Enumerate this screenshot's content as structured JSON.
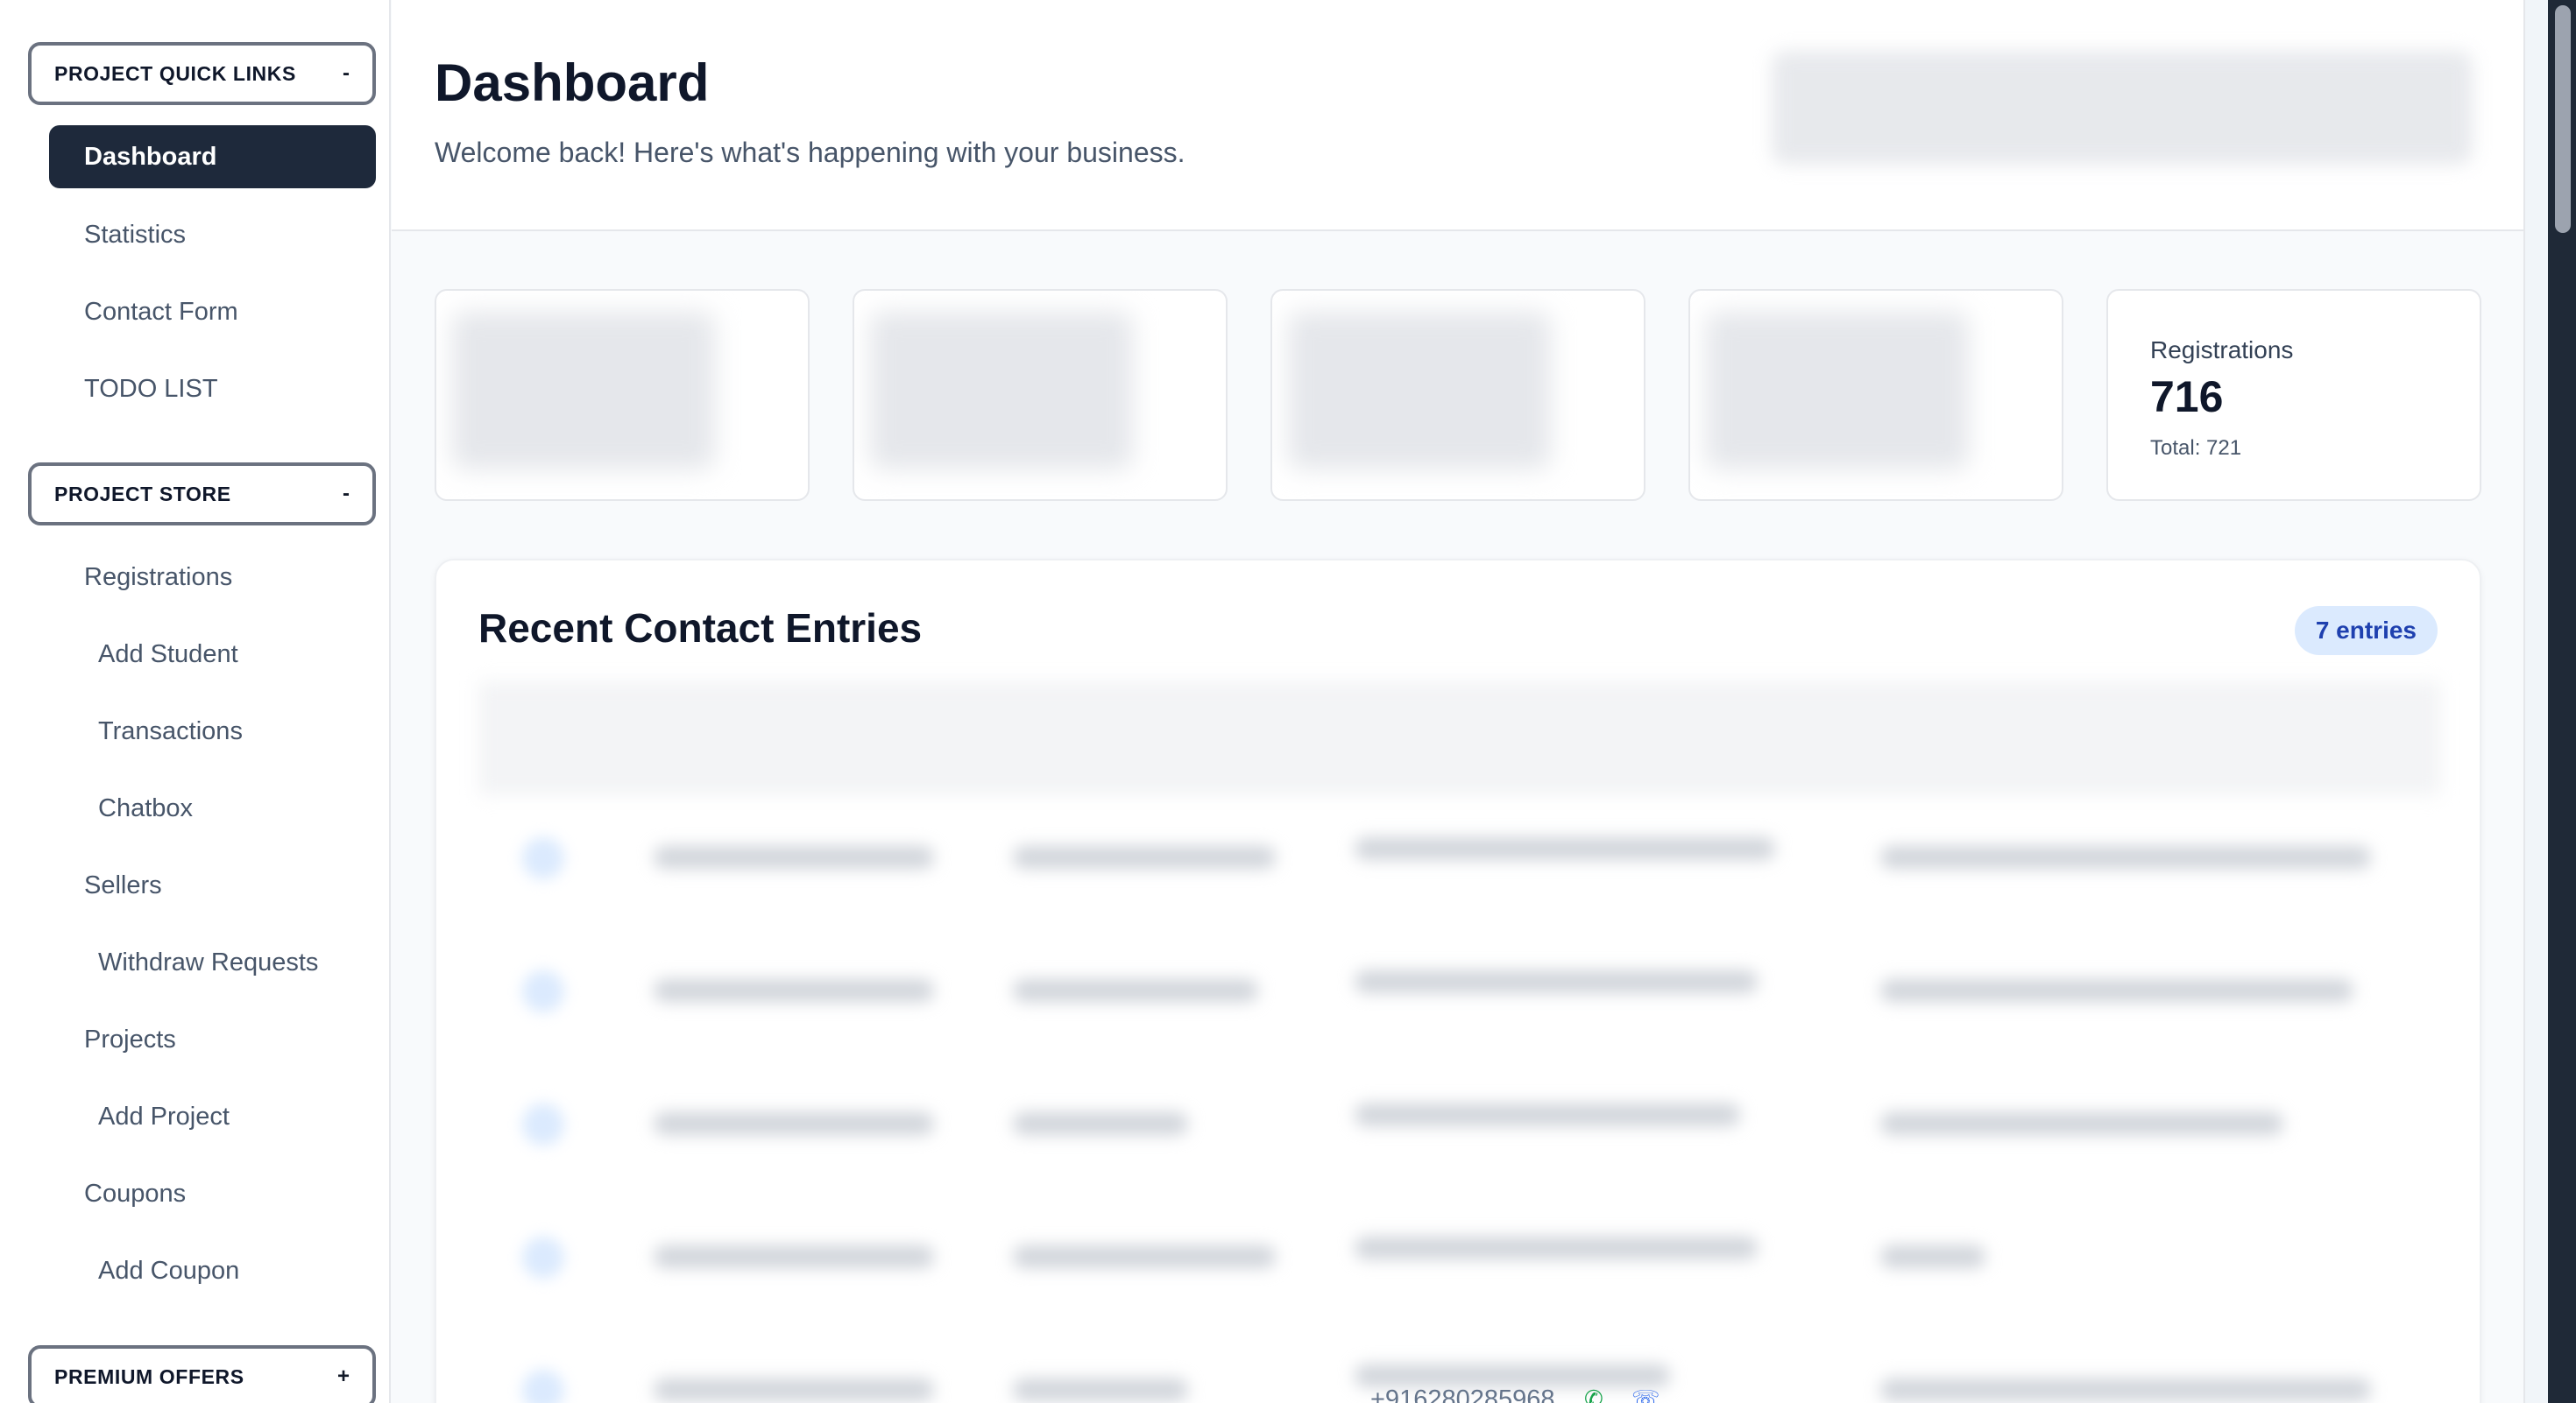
{
  "sidebar": {
    "groups": [
      {
        "label": "PROJECT QUICK LINKS",
        "toggle": "-"
      },
      {
        "label": "PROJECT STORE",
        "toggle": "-"
      },
      {
        "label": "PREMIUM OFFERS",
        "toggle": "+"
      }
    ],
    "quick_links": [
      "Dashboard",
      "Statistics",
      "Contact Form",
      "TODO LIST"
    ],
    "store_items": [
      "Registrations",
      "Add Student",
      "Transactions",
      "Chatbox",
      "Sellers",
      "Withdraw Requests",
      "Projects",
      "Add Project",
      "Coupons",
      "Add Coupon"
    ]
  },
  "header": {
    "title": "Dashboard",
    "subtitle": "Welcome back! Here's what's happening with your business."
  },
  "stats": {
    "registrations": {
      "label": "Registrations",
      "value": "716",
      "total": "Total: 721"
    }
  },
  "recent_entries": {
    "title": "Recent Contact Entries",
    "badge": "7 entries",
    "visible_phone": "+916280285968"
  },
  "colors": {
    "active_nav_bg": "#1e293b",
    "badge_bg": "#dbeafe",
    "badge_text": "#1e40af"
  },
  "icons": {
    "whatsapp": "whatsapp-icon",
    "phone": "phone-icon"
  }
}
